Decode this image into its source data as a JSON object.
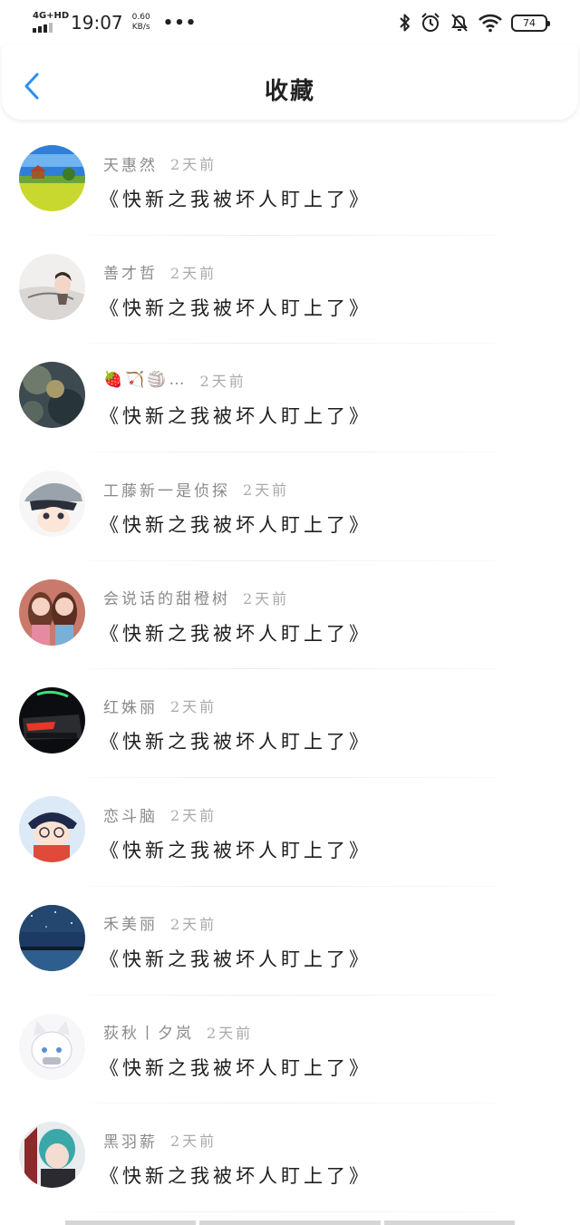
{
  "status_bar": {
    "network": "4G+HD",
    "time": "19:07",
    "speed_value": "0.60",
    "speed_unit": "KB/s",
    "more": "•••",
    "battery": "74"
  },
  "header": {
    "title": "收藏"
  },
  "favorites": [
    {
      "name": "天惠然",
      "time": "2天前",
      "book": "《快新之我被坏人盯上了》",
      "avatar": "landscape-avatar"
    },
    {
      "name": "善才哲",
      "time": "2天前",
      "book": "《快新之我被坏人盯上了》",
      "avatar": "anime-sketch-avatar"
    },
    {
      "name": "🍓🏹🏐…",
      "time": "2天前",
      "book": "《快新之我被坏人盯上了》",
      "avatar": "painting-avatar"
    },
    {
      "name": "工藤新一是侦探",
      "time": "2天前",
      "book": "《快新之我被坏人盯上了》",
      "avatar": "anime-boy-avatar"
    },
    {
      "name": "会说话的甜橙树",
      "time": "2天前",
      "book": "《快新之我被坏人盯上了》",
      "avatar": "dolls-avatar"
    },
    {
      "name": "红姝丽",
      "time": "2天前",
      "book": "《快新之我被坏人盯上了》",
      "avatar": "car-avatar"
    },
    {
      "name": "恋斗脑",
      "time": "2天前",
      "book": "《快新之我被坏人盯上了》",
      "avatar": "cartoon-boy-avatar"
    },
    {
      "name": "禾美丽",
      "time": "2天前",
      "book": "《快新之我被坏人盯上了》",
      "avatar": "night-sky-avatar"
    },
    {
      "name": "荻秋丨夕岚",
      "time": "2天前",
      "book": "《快新之我被坏人盯上了》",
      "avatar": "white-cat-girl-avatar"
    },
    {
      "name": "黑羽薪",
      "time": "2天前",
      "book": "《快新之我被坏人盯上了》",
      "avatar": "teal-hair-girl-avatar"
    }
  ],
  "icons": {
    "back": "chevron-left-icon",
    "bluetooth": "bluetooth-icon",
    "alarm": "alarm-icon",
    "mute": "bell-off-icon",
    "wifi": "wifi-icon"
  },
  "colors": {
    "accent": "#2a8ff0",
    "name_text": "#8a8a8a",
    "time_text": "#aaaaaa",
    "title_text": "#1e1e1e"
  }
}
